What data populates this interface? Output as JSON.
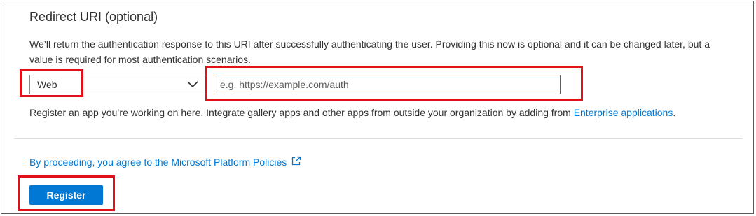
{
  "section": {
    "title": "Redirect URI (optional)",
    "description": "We’ll return the authentication response to this URI after successfully authenticating the user. Providing this now is optional and it can be changed later, but a value is required for most authentication scenarios."
  },
  "platform_select": {
    "value": "Web",
    "icon": "chevron-down-icon"
  },
  "uri_input": {
    "value": "",
    "placeholder": "e.g. https://example.com/auth"
  },
  "help": {
    "text": "Register an app you’re working on here. Integrate gallery apps and other apps from outside your organization by adding from ",
    "link_text": "Enterprise applications",
    "suffix": "."
  },
  "policy": {
    "text": "By proceeding, you agree to the Microsoft Platform Policies",
    "icon": "external-link-icon"
  },
  "actions": {
    "register_label": "Register"
  },
  "colors": {
    "accent": "#0078d4",
    "highlight": "#e2101b",
    "text": "#323130"
  }
}
